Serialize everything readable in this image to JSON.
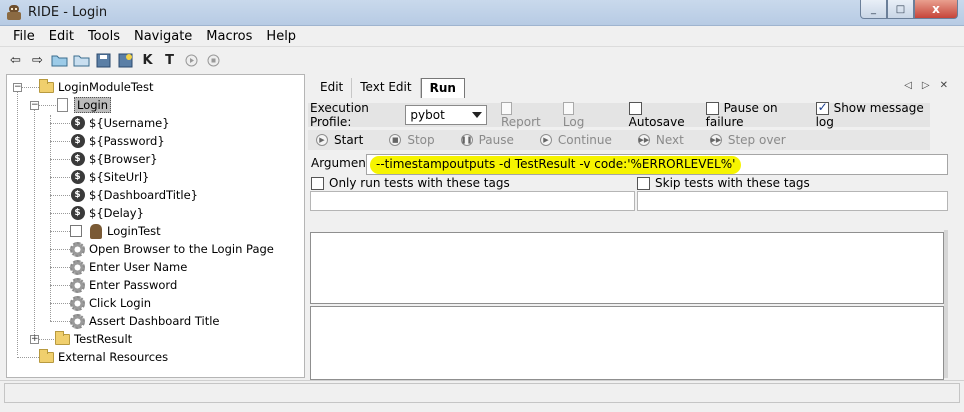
{
  "window": {
    "title": "RIDE - Login",
    "minimize": "_",
    "maximize": "□",
    "close": "x"
  },
  "menu": [
    "File",
    "Edit",
    "Tools",
    "Navigate",
    "Macros",
    "Help"
  ],
  "toolbar_icons": [
    "back-arrow-icon",
    "forward-arrow-icon",
    "open-folder-icon",
    "folder-icon",
    "save-icon",
    "save-all-icon",
    "keyword-search-icon",
    "test-search-icon",
    "run-icon",
    "stop-icon"
  ],
  "toolbar_glyphs": {
    "back": "⇦",
    "forward": "⇨",
    "k": "K",
    "t": "T"
  },
  "tree": {
    "suite": "LoginModuleTest",
    "test_file": "Login",
    "variables": [
      "${Username}",
      "${Password}",
      "${Browser}",
      "${SiteUrl}",
      "${DashboardTitle}",
      "${Delay}"
    ],
    "test_case": "LoginTest",
    "keywords": [
      "Open Browser to the Login Page",
      "Enter User Name",
      "Enter Password",
      "Click Login",
      "Assert Dashboard Title"
    ],
    "other_suite": "TestResult",
    "resources": "External Resources"
  },
  "tabs": [
    "Edit",
    "Text Edit",
    "Run"
  ],
  "run": {
    "profile_label": "Execution Profile:",
    "profile_value": "pybot",
    "report": "Report",
    "log": "Log",
    "autosave": "Autosave",
    "pause_on_failure": "Pause on failure",
    "show_message_log": "Show message log",
    "controls": [
      "Start",
      "Stop",
      "Pause",
      "Continue",
      "Next",
      "Step over"
    ],
    "arguments_label": "Arguments:",
    "arguments_value": "--timestampoutputs -d TestResult -v code:'%ERRORLEVEL%'",
    "only_run_tags": "Only run tests with these tags",
    "skip_tags": "Skip tests with these tags"
  }
}
